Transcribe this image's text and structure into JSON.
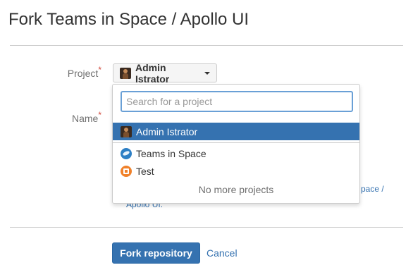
{
  "page": {
    "title": "Fork Teams in Space / Apollo UI"
  },
  "form": {
    "project_label": "Project",
    "name_label": "Name",
    "required_mark": "*",
    "selected_project": "Admin Istrator",
    "location_text_right": "pace /",
    "location_text_left": "Apollo UI."
  },
  "dropdown": {
    "search_placeholder": "Search for a project",
    "selected_item": "Admin Istrator",
    "items": [
      {
        "label": "Teams in Space",
        "icon": "space-icon"
      },
      {
        "label": "Test",
        "icon": "test-icon"
      }
    ],
    "footer": "No more projects"
  },
  "actions": {
    "fork_label": "Fork repository",
    "cancel_label": "Cancel"
  },
  "colors": {
    "primary": "#3572b0",
    "required": "#d04437",
    "focus_border": "#6aa0d6"
  }
}
